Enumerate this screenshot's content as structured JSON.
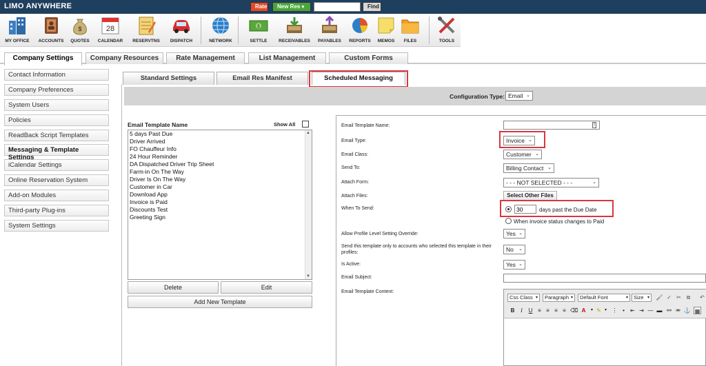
{
  "topbar": {
    "logo": "LIMO ANYWHERE",
    "rate_label": "Rate",
    "newres_label": "New Res",
    "newres_caret": "▾",
    "search_value": "",
    "find_label": "Find"
  },
  "toolbar": {
    "items": [
      {
        "label": "MY OFFICE",
        "icon": "building-icon"
      },
      {
        "label": "ACCOUNTS",
        "icon": "address-book-icon"
      },
      {
        "label": "QUOTES",
        "icon": "money-bag-icon"
      },
      {
        "label": "CALENDAR",
        "icon": "calendar-icon",
        "day": "28"
      },
      {
        "label": "RESERVTNS",
        "icon": "notepad-icon"
      },
      {
        "label": "DISPATCH",
        "icon": "car-icon"
      },
      {
        "label": "NETWORK",
        "icon": "globe-icon"
      },
      {
        "label": "SETTLE",
        "icon": "cash-icon"
      },
      {
        "label": "RECEIVABLES",
        "icon": "inbox-icon"
      },
      {
        "label": "PAYABLES",
        "icon": "outbox-icon"
      },
      {
        "label": "REPORTS",
        "icon": "pie-chart-icon"
      },
      {
        "label": "MEMOS",
        "icon": "sticky-note-icon"
      },
      {
        "label": "FILES",
        "icon": "folder-icon"
      },
      {
        "label": "TOOLS",
        "icon": "tools-icon"
      }
    ]
  },
  "main_tabs": [
    {
      "label": "Company Settings",
      "active": true
    },
    {
      "label": "Company Resources",
      "active": false
    },
    {
      "label": "Rate Management",
      "active": false
    },
    {
      "label": "List Management",
      "active": false
    },
    {
      "label": "Custom Forms",
      "active": false
    }
  ],
  "sidebar": {
    "items": [
      {
        "label": "Contact Information",
        "active": false
      },
      {
        "label": "Company Preferences",
        "active": false
      },
      {
        "label": "System Users",
        "active": false
      },
      {
        "label": "Policies",
        "active": false
      },
      {
        "label": "ReadBack Script Templates",
        "active": false
      },
      {
        "label": "Messaging & Template Settings",
        "active": true
      },
      {
        "label": "iCalendar Settings",
        "active": false
      },
      {
        "label": "Online Reservation System",
        "active": false
      },
      {
        "label": "Add-on Modules",
        "active": false
      },
      {
        "label": "Third-party Plug-ins",
        "active": false
      },
      {
        "label": "System Settings",
        "active": false
      }
    ]
  },
  "sub_tabs": [
    {
      "label": "Standard Settings",
      "active": false
    },
    {
      "label": "Email Res Manifest",
      "active": false
    },
    {
      "label": "Scheduled Messaging",
      "active": true
    }
  ],
  "config": {
    "label": "Configuration Type:",
    "value": "Email"
  },
  "templates": {
    "title": "Email Template Name",
    "show_all": "Show All",
    "items": [
      "5 days Past Due",
      "Driver Arrived",
      "FO Chauffeur Info",
      "24 Hour Reminder",
      "DA Dispatched Driver Trip Sheet",
      "Farm-in On The Way",
      "Driver Is On The Way",
      "Customer in Car",
      "Download App",
      "Invoice is Paid",
      "Discounts Test",
      "Greeting Sign"
    ],
    "delete_label": "Delete",
    "edit_label": "Edit",
    "add_label": "Add New Template"
  },
  "form": {
    "name_label": "Email Template Name:",
    "name_value": "",
    "type_label": "Email Type:",
    "type_value": "Invoice",
    "class_label": "Email Class:",
    "class_value": "Customer",
    "sendto_label": "Send To:",
    "sendto_value": "Billing Contact",
    "attachform_label": "Attach Form:",
    "attachform_value": "- - - NOT SELECTED - - -",
    "attachfiles_label": "Attach Files:",
    "attachfiles_button": "Select Other Files",
    "when_label": "When To Send:",
    "days_value": "30",
    "days_suffix": "days past the Due Date",
    "when_option2": "When invoice status changes to Paid",
    "override_label": "Allow Profile Level Setting Override:",
    "override_value": "Yes",
    "sendonly_label": "Send this template only to accounts who selected this template in their profiles:",
    "sendonly_value": "No",
    "active_label": "Is Active:",
    "active_value": "Yes",
    "subject_label": "Email Subject:",
    "subject_value": "",
    "content_label": "Email Template Content:"
  },
  "editor": {
    "css_class": "Css Class",
    "paragraph": "Paragraph",
    "font": "Default Font",
    "size": "Size",
    "bold": "B",
    "italic": "I",
    "underline": "U"
  },
  "colors": {
    "topbar": "#1f3f5e",
    "rate": "#e04b2c",
    "newres": "#4aa53c",
    "highlight": "#d9363e"
  }
}
